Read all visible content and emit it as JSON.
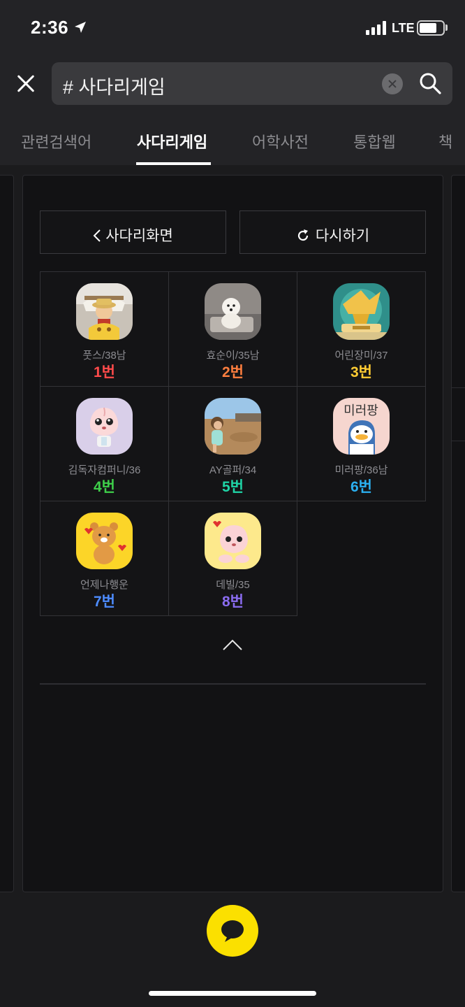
{
  "status_bar": {
    "time": "2:36",
    "network": "LTE"
  },
  "search": {
    "query": "# 사다리게임"
  },
  "tabs": [
    {
      "label": "관련검색어"
    },
    {
      "label": "사다리게임"
    },
    {
      "label": "어학사전"
    },
    {
      "label": "통합웹"
    },
    {
      "label": "책"
    }
  ],
  "active_tab": "사다리게임",
  "actions": {
    "back_label": "사다리화면",
    "retry_label": "다시하기"
  },
  "participants": [
    {
      "name": "풋스/38남",
      "number": "1번",
      "color": "#ff4b4b",
      "avatar": "one-piece-figure-photo"
    },
    {
      "name": "효순이/35남",
      "number": "2번",
      "color": "#ff7f3f",
      "avatar": "white-dog-photo"
    },
    {
      "name": "어린장미/37",
      "number": "3번",
      "color": "#ffcc33",
      "avatar": "golden-trophy-photo"
    },
    {
      "name": "김독자컴퍼니/36",
      "number": "4번",
      "color": "#3ecf4a",
      "avatar": "apeach-character"
    },
    {
      "name": "AY골퍼/34",
      "number": "5번",
      "color": "#1fd4a6",
      "avatar": "child-outdoor-photo"
    },
    {
      "name": "미러팡/36남",
      "number": "6번",
      "color": "#2bb0f0",
      "avatar": "duck-character",
      "avatar_text": "미러팡"
    },
    {
      "name": "언제나행운",
      "number": "7번",
      "color": "#4d8cff",
      "avatar": "ryan-character"
    },
    {
      "name": "데빌/35",
      "number": "8번",
      "color": "#8a6cf0",
      "avatar": "apeach-heart-character"
    }
  ],
  "colors": {
    "accent_yellow": "#fbe000",
    "background": "#1b1b1d",
    "card": "#121214"
  }
}
